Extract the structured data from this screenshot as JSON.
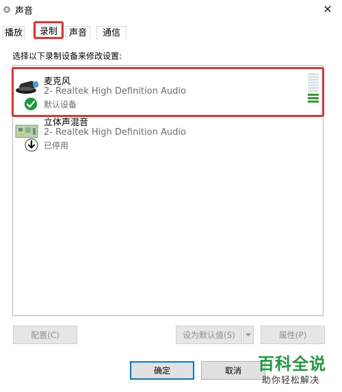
{
  "window": {
    "title": "声音"
  },
  "tabs": [
    "播放",
    "录制",
    "声音",
    "通信"
  ],
  "instruction": "选择以下录制设备来修改设置:",
  "devices": [
    {
      "name": "麦克风",
      "description": "2- Realtek High Definition Audio",
      "status": "默认设备",
      "icon": "microphone-icon",
      "status_icon": "check-icon",
      "level_bars": 10,
      "level_active": 3
    },
    {
      "name": "立体声混音",
      "description": "2- Realtek High Definition Audio",
      "status": "已停用",
      "icon": "circuit-board-icon",
      "status_icon": "arrow-down-icon"
    }
  ],
  "buttons": {
    "configure": "配置(C)",
    "set_default": "设为默认值(S)",
    "properties": "属性(P)",
    "ok": "确定",
    "cancel": "取消"
  },
  "watermark": {
    "brand": "百科全说",
    "slogan": "助你轻松解决"
  },
  "colors": {
    "highlight": "#e8302c",
    "level_green": "#2aa12a",
    "check_green": "#1a9c3a",
    "primary_border": "#0078d7"
  }
}
